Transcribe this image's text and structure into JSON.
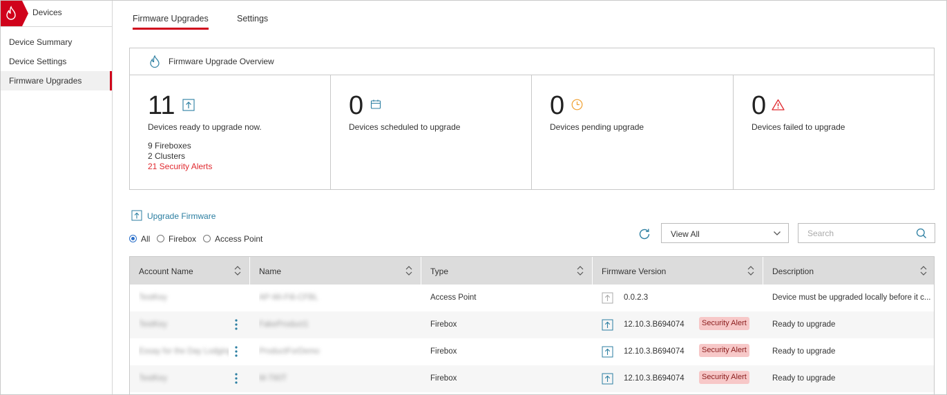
{
  "app": {
    "title": "Devices",
    "brand_color": "#d0021b"
  },
  "sidebar": {
    "items": [
      {
        "label": "Device Summary",
        "active": false
      },
      {
        "label": "Device Settings",
        "active": false
      },
      {
        "label": "Firmware Upgrades",
        "active": true
      }
    ]
  },
  "tabs": [
    {
      "label": "Firmware Upgrades",
      "active": true
    },
    {
      "label": "Settings",
      "active": false
    }
  ],
  "overview": {
    "title": "Firmware Upgrade Overview",
    "icon": "droplet-icon",
    "stats": [
      {
        "value": "11",
        "label": "Devices ready to upgrade now.",
        "icon": "upload-icon",
        "details": [
          "9 Fireboxes",
          "2 Clusters"
        ],
        "alert": "21 Security Alerts"
      },
      {
        "value": "0",
        "label": "Devices scheduled to upgrade",
        "icon": "calendar-icon"
      },
      {
        "value": "0",
        "label": "Devices pending upgrade",
        "icon": "clock-icon"
      },
      {
        "value": "0",
        "label": "Devices failed to upgrade",
        "icon": "warning-icon"
      }
    ]
  },
  "toolbar": {
    "upgrade_label": "Upgrade Firmware",
    "filters": [
      {
        "label": "All",
        "checked": true
      },
      {
        "label": "Firebox",
        "checked": false
      },
      {
        "label": "Access Point",
        "checked": false
      }
    ],
    "view_select": "View All",
    "search_placeholder": "Search"
  },
  "table": {
    "columns": [
      "Account Name",
      "Name",
      "Type",
      "Firmware Version",
      "Description"
    ],
    "rows": [
      {
        "account": "TestKey",
        "name": "AP-Wi-Fi6-CFBL",
        "type": "Access Point",
        "firmware": "0.0.2.3",
        "badge": "",
        "description": "Device must be upgraded locally before it c...",
        "menu": false
      },
      {
        "account": "TestKey",
        "name": "FakeProduct1",
        "type": "Firebox",
        "firmware": "12.10.3.B694074",
        "badge": "Security Alert",
        "description": "Ready to upgrade",
        "menu": true
      },
      {
        "account": "Essay for the Day Lodging",
        "name": "ProductForDemo",
        "type": "Firebox",
        "firmware": "12.10.3.B694074",
        "badge": "Security Alert",
        "description": "Ready to upgrade",
        "menu": true
      },
      {
        "account": "TestKey",
        "name": "M-T60T",
        "type": "Firebox",
        "firmware": "12.10.3.B694074",
        "badge": "Security Alert",
        "description": "Ready to upgrade",
        "menu": true
      }
    ]
  }
}
